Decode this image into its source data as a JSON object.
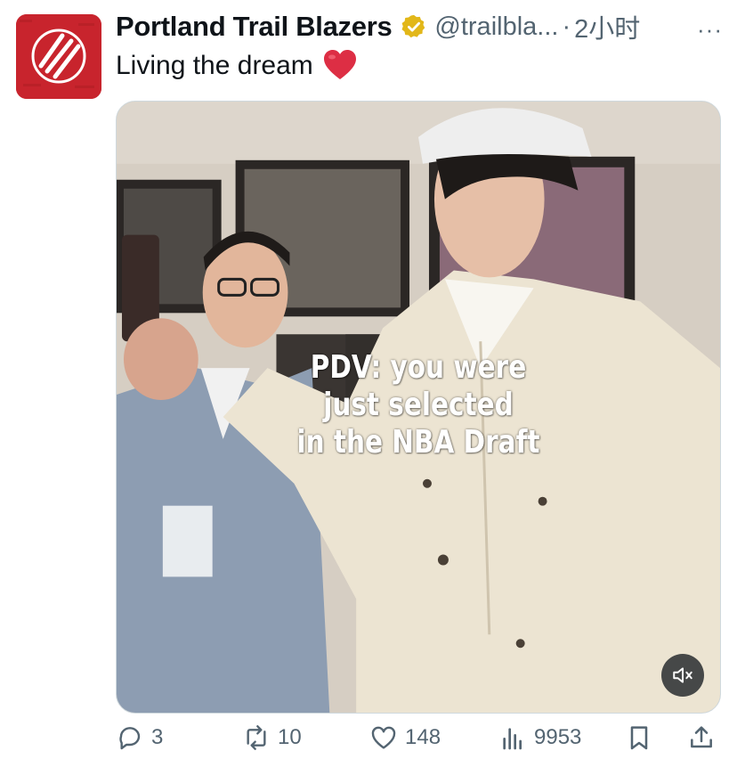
{
  "tweet": {
    "author_name": "Portland Trail Blazers",
    "handle": "@trailbla...",
    "separator": "·",
    "time": "2小时",
    "more_label": "···",
    "text": "Living the dream",
    "emoji_icon": "red-heart-icon"
  },
  "media": {
    "caption_lines": [
      "PDV: you were",
      "just selected",
      "in the NBA Draft"
    ],
    "mute_icon": "speaker-muted-icon"
  },
  "actions": {
    "replies": "3",
    "reposts": "10",
    "likes": "148",
    "views": "9953"
  },
  "colors": {
    "brand_red": "#c8242d",
    "verified_gold": "#e2b719",
    "secondary_text": "#536471"
  }
}
